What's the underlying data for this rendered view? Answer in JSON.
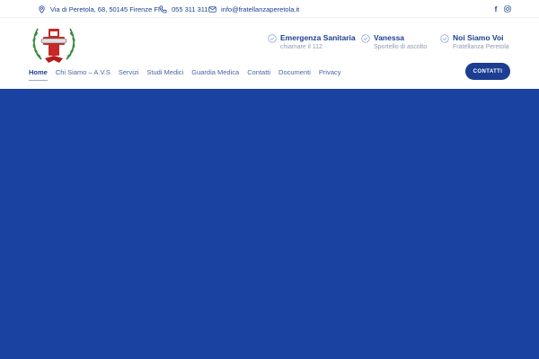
{
  "topbar": {
    "address": "Via di Peretola, 68, 50145 Firenze FI",
    "phone": "055 311 311",
    "email": "info@fratellanzaperetola.it",
    "social": [
      {
        "icon": "facebook-icon",
        "glyph": "f"
      },
      {
        "icon": "instagram-icon",
        "glyph": ""
      }
    ]
  },
  "features": [
    {
      "title": "Emergenza Sanitaria",
      "subtitle": "chiamare il 112",
      "icon": "check-circle-icon"
    },
    {
      "title": "Vanessa",
      "subtitle": "Sportello di ascolto",
      "icon": "check-circle-icon"
    },
    {
      "title": "Noi Siamo Voi",
      "subtitle": "Fratellanza Peretola",
      "icon": "check-circle-icon"
    }
  ],
  "nav": {
    "items": [
      {
        "label": "Home",
        "active": true
      },
      {
        "label": "Chi Siamo – A.V.S",
        "active": false
      },
      {
        "label": "Servizi",
        "active": false
      },
      {
        "label": "Studi Medici",
        "active": false
      },
      {
        "label": "Guardia Medica",
        "active": false
      },
      {
        "label": "Contatti",
        "active": false
      },
      {
        "label": "Documenti",
        "active": false
      },
      {
        "label": "Privacy",
        "active": false
      }
    ],
    "cta_label": "CONTATTI"
  },
  "colors": {
    "brand": "#1c3e92",
    "hero": "#1a42a0",
    "muted": "#8f9bb3"
  }
}
